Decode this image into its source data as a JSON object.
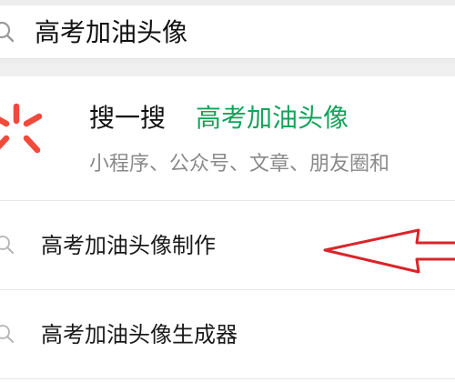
{
  "search": {
    "query": "高考加油头像",
    "icon": "search-icon"
  },
  "souyisou": {
    "title": "搜一搜",
    "query": "高考加油头像",
    "subtitle": "小程序、公众号、文章、朋友圈和",
    "logo_icon": "souyisou-logo-icon",
    "accent_color": "#13a35a",
    "logo_color": "#f04a3a"
  },
  "suggestions": [
    {
      "text": "高考加油头像制作",
      "icon": "search-icon"
    },
    {
      "text": "高考加油头像生成器",
      "icon": "search-icon"
    }
  ],
  "annotation": {
    "icon": "arrow-left-icon",
    "color": "#d9252a"
  }
}
